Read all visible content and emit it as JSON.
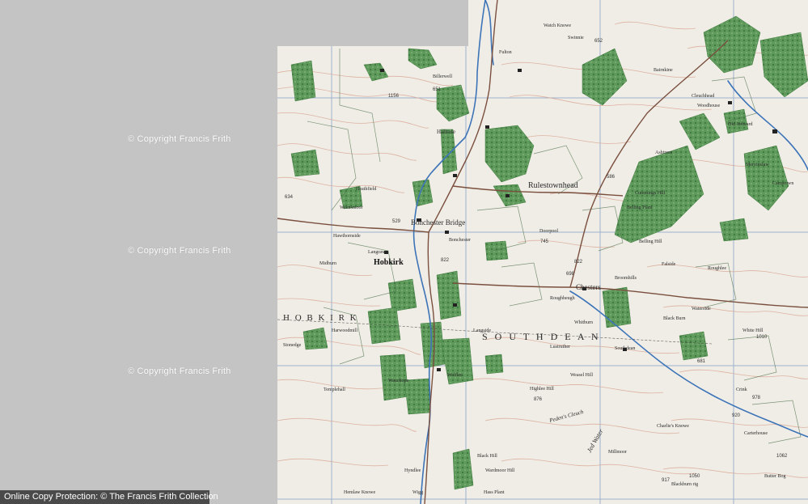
{
  "watermark": {
    "text": "© Copyright Francis Frith"
  },
  "footer": {
    "text": "Online Copy Protection: © The Francis Frith Collection"
  },
  "colors": {
    "background": "#c4c4c4",
    "paper": "#f0ede6",
    "contour": "#d9a896",
    "woodland": "#5f9a5c",
    "river": "#3d74b8",
    "road": "#7a4f3e",
    "grid": "#8aa6c9"
  },
  "labels": {
    "hobkirk_parish": "H O B K I R K",
    "southdean_parish": "S O U T H D E A N",
    "hobkirk": "Hobkirk",
    "bonchester_bridge": "Bonchester Bridge",
    "bonchester": "Bonchester",
    "rulestonehead": "Rulestownhead",
    "chesters": "Chesters",
    "southdean": "Southdean",
    "hallrule": "Hallrule",
    "langraw": "Langraw",
    "hawthornside": "Hawthornside",
    "weensmoor": "Weensmoor",
    "heathtfield": "Heathfield",
    "midburn": "Midburn",
    "harwoodmill": "Harwoodmill",
    "wauchope": "Wauchope",
    "templehall": "Templehall",
    "stonedge": "Stonedge",
    "doorpool": "Doorpool",
    "broomhills": "Broomhills",
    "belling_plant": "Belling Plant",
    "whitburn": "Whitburn",
    "lustruther": "Lustruther",
    "wolflee": "Wolflee",
    "hallrule_mill": "Billerwell",
    "fulton": "Fulton",
    "watch_knowe": "Watch Knowe",
    "bairnkine": "Bairnkine",
    "cleuchhead": "Cleuchhead",
    "old_jedward": "Old Jedward",
    "swinnie": "Swinnie",
    "woodhouse": "Woodhouse",
    "ashtrees": "Ashtrees",
    "cummings_hill": "Cummings Hill",
    "belling_hill": "Belling Hill",
    "mervinslaw": "Mervinslaw",
    "camptown": "Camptown",
    "falside": "Falside",
    "roughlee": "Roughlee",
    "waterside": "Waterside",
    "black_burn": "Black Burn",
    "white_hill": "White Hill",
    "crinkle": "Crink",
    "carterhouse": "Carterhouse",
    "charlies_knowe": "Charlie's Knowe",
    "millmoor": "Millmoor",
    "wardmoor_hill": "Wardmoor Hill",
    "black_hill": "Black Hill",
    "hass_plant": "Hass Plant",
    "hemlaw_knowe": "Hemlaw Knowe",
    "wigg": "Wigg",
    "hyndlee": "Hyndlee",
    "highlee_hill": "Highlee Hill",
    "weasel_hill": "Weasel Hill",
    "jed_water": "Jed Water",
    "pedens_cleuch": "Peden's Cleuch",
    "rogheugh": "Roughheugh",
    "langside": "Langside",
    "lodge": "Lodge",
    "kirkton": "Kirkton",
    "southdean_rig": "Southdean rig",
    "crook": "Crook",
    "blackburn_rig": "Blackburn rig",
    "butter_bog": "Butter Bog"
  },
  "spot_heights": [
    "652",
    "822",
    "698",
    "586",
    "745",
    "1156",
    "634",
    "529",
    "822",
    "1010",
    "978",
    "917",
    "1050",
    "876",
    "651",
    "920",
    "1062",
    "681"
  ]
}
